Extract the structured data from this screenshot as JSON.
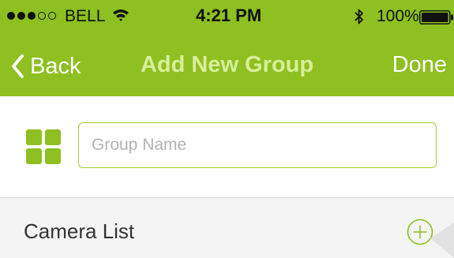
{
  "status_bar": {
    "carrier": "BELL",
    "signal_bars_filled": 3,
    "signal_bars_total": 5,
    "time": "4:21 PM",
    "battery": "100%"
  },
  "nav": {
    "back_label": "Back",
    "title": "Add New Group",
    "done_label": "Done"
  },
  "group_form": {
    "name_placeholder": "Group Name",
    "name_value": ""
  },
  "camera_list": {
    "header": "Camera List"
  },
  "colors": {
    "accent": "#8dc020",
    "title_text": "#d8ee9a",
    "input_border": "#a3cc3a"
  },
  "icons": {
    "back": "chevron-left-icon",
    "grid": "grid-icon",
    "add": "plus-circle-icon",
    "wifi": "wifi-icon",
    "bluetooth": "bluetooth-icon",
    "battery": "battery-icon"
  }
}
